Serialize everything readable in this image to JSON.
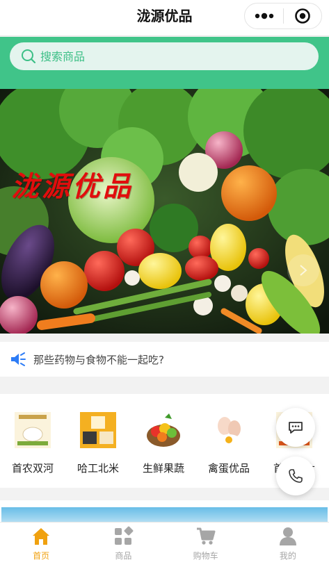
{
  "app": {
    "title": "泷源优品"
  },
  "search": {
    "placeholder": "搜索商品",
    "icon": "search-icon"
  },
  "banner": {
    "logo_text": "泷源优品"
  },
  "notice": {
    "text": "那些药物与食物不能一起吃?",
    "icon": "speaker-icon"
  },
  "categories": [
    {
      "label": "首农双河",
      "icon": "rice-bag-icon"
    },
    {
      "label": "哈工北米",
      "icon": "rice-box-icon"
    },
    {
      "label": "生鲜果蔬",
      "icon": "fruit-basket-icon"
    },
    {
      "label": "禽蛋优品",
      "icon": "eggs-icon"
    },
    {
      "label": "首农双大",
      "icon": "rice-bag-icon"
    }
  ],
  "fabs": [
    {
      "icon": "chat-icon"
    },
    {
      "icon": "phone-icon"
    }
  ],
  "tabbar": [
    {
      "label": "首页",
      "icon": "home-icon",
      "active": true
    },
    {
      "label": "商品",
      "icon": "grid-icon",
      "active": false
    },
    {
      "label": "购物车",
      "icon": "cart-icon",
      "active": false
    },
    {
      "label": "我的",
      "icon": "user-icon",
      "active": false
    }
  ],
  "colors": {
    "accent": "#40c489",
    "tab_active": "#f0a10f",
    "tab_inactive": "#a6a6a6",
    "notice_icon": "#2d7cf6"
  }
}
